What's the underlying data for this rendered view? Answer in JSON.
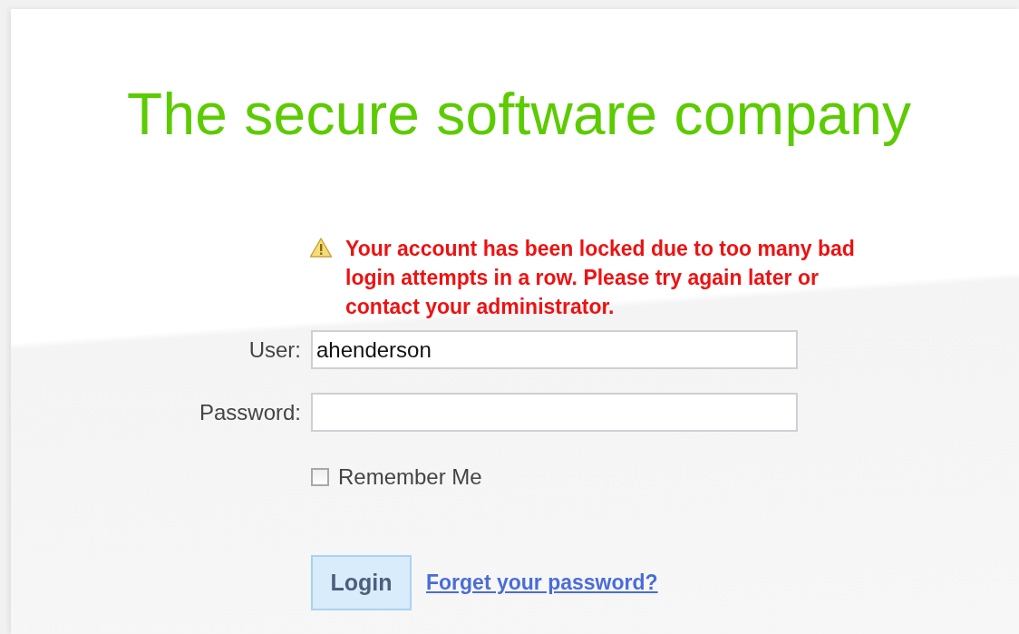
{
  "brand": {
    "tagline": "The secure software company"
  },
  "alert": {
    "message": "Your account has been locked due to too many bad login attempts in a row. Please try again later or contact your administrator."
  },
  "fields": [
    {
      "label": "User:",
      "value": "ahenderson",
      "kind": "text"
    },
    {
      "label": "Password:",
      "kind": "password"
    }
  ],
  "remember": {
    "label": "Remember Me",
    "checked": false
  },
  "login_button": "Login",
  "forgot_link": "Forget your password?"
}
